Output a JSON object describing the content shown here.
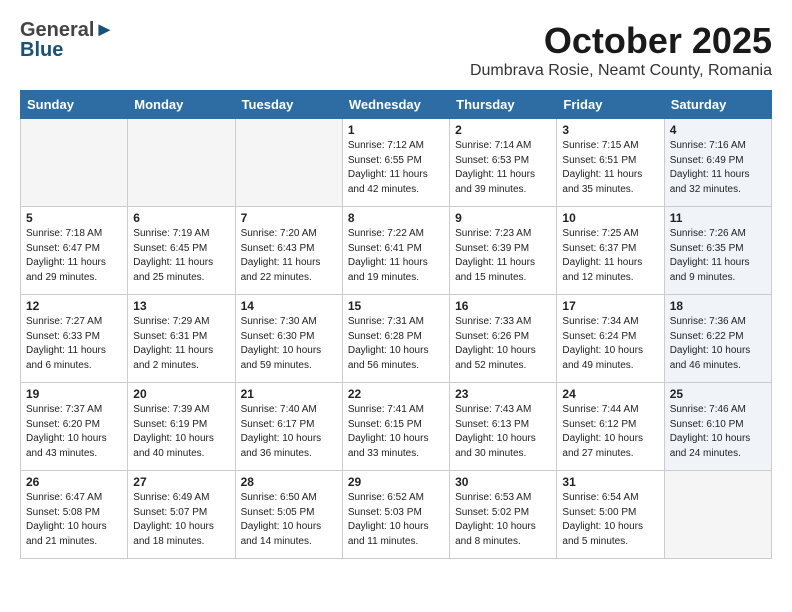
{
  "header": {
    "logo_general": "General",
    "logo_blue": "Blue",
    "month": "October 2025",
    "location": "Dumbrava Rosie, Neamt County, Romania"
  },
  "days_of_week": [
    "Sunday",
    "Monday",
    "Tuesday",
    "Wednesday",
    "Thursday",
    "Friday",
    "Saturday"
  ],
  "weeks": [
    [
      {
        "day": "",
        "info": ""
      },
      {
        "day": "",
        "info": ""
      },
      {
        "day": "",
        "info": ""
      },
      {
        "day": "1",
        "info": "Sunrise: 7:12 AM\nSunset: 6:55 PM\nDaylight: 11 hours\nand 42 minutes."
      },
      {
        "day": "2",
        "info": "Sunrise: 7:14 AM\nSunset: 6:53 PM\nDaylight: 11 hours\nand 39 minutes."
      },
      {
        "day": "3",
        "info": "Sunrise: 7:15 AM\nSunset: 6:51 PM\nDaylight: 11 hours\nand 35 minutes."
      },
      {
        "day": "4",
        "info": "Sunrise: 7:16 AM\nSunset: 6:49 PM\nDaylight: 11 hours\nand 32 minutes."
      }
    ],
    [
      {
        "day": "5",
        "info": "Sunrise: 7:18 AM\nSunset: 6:47 PM\nDaylight: 11 hours\nand 29 minutes."
      },
      {
        "day": "6",
        "info": "Sunrise: 7:19 AM\nSunset: 6:45 PM\nDaylight: 11 hours\nand 25 minutes."
      },
      {
        "day": "7",
        "info": "Sunrise: 7:20 AM\nSunset: 6:43 PM\nDaylight: 11 hours\nand 22 minutes."
      },
      {
        "day": "8",
        "info": "Sunrise: 7:22 AM\nSunset: 6:41 PM\nDaylight: 11 hours\nand 19 minutes."
      },
      {
        "day": "9",
        "info": "Sunrise: 7:23 AM\nSunset: 6:39 PM\nDaylight: 11 hours\nand 15 minutes."
      },
      {
        "day": "10",
        "info": "Sunrise: 7:25 AM\nSunset: 6:37 PM\nDaylight: 11 hours\nand 12 minutes."
      },
      {
        "day": "11",
        "info": "Sunrise: 7:26 AM\nSunset: 6:35 PM\nDaylight: 11 hours\nand 9 minutes."
      }
    ],
    [
      {
        "day": "12",
        "info": "Sunrise: 7:27 AM\nSunset: 6:33 PM\nDaylight: 11 hours\nand 6 minutes."
      },
      {
        "day": "13",
        "info": "Sunrise: 7:29 AM\nSunset: 6:31 PM\nDaylight: 11 hours\nand 2 minutes."
      },
      {
        "day": "14",
        "info": "Sunrise: 7:30 AM\nSunset: 6:30 PM\nDaylight: 10 hours\nand 59 minutes."
      },
      {
        "day": "15",
        "info": "Sunrise: 7:31 AM\nSunset: 6:28 PM\nDaylight: 10 hours\nand 56 minutes."
      },
      {
        "day": "16",
        "info": "Sunrise: 7:33 AM\nSunset: 6:26 PM\nDaylight: 10 hours\nand 52 minutes."
      },
      {
        "day": "17",
        "info": "Sunrise: 7:34 AM\nSunset: 6:24 PM\nDaylight: 10 hours\nand 49 minutes."
      },
      {
        "day": "18",
        "info": "Sunrise: 7:36 AM\nSunset: 6:22 PM\nDaylight: 10 hours\nand 46 minutes."
      }
    ],
    [
      {
        "day": "19",
        "info": "Sunrise: 7:37 AM\nSunset: 6:20 PM\nDaylight: 10 hours\nand 43 minutes."
      },
      {
        "day": "20",
        "info": "Sunrise: 7:39 AM\nSunset: 6:19 PM\nDaylight: 10 hours\nand 40 minutes."
      },
      {
        "day": "21",
        "info": "Sunrise: 7:40 AM\nSunset: 6:17 PM\nDaylight: 10 hours\nand 36 minutes."
      },
      {
        "day": "22",
        "info": "Sunrise: 7:41 AM\nSunset: 6:15 PM\nDaylight: 10 hours\nand 33 minutes."
      },
      {
        "day": "23",
        "info": "Sunrise: 7:43 AM\nSunset: 6:13 PM\nDaylight: 10 hours\nand 30 minutes."
      },
      {
        "day": "24",
        "info": "Sunrise: 7:44 AM\nSunset: 6:12 PM\nDaylight: 10 hours\nand 27 minutes."
      },
      {
        "day": "25",
        "info": "Sunrise: 7:46 AM\nSunset: 6:10 PM\nDaylight: 10 hours\nand 24 minutes."
      }
    ],
    [
      {
        "day": "26",
        "info": "Sunrise: 6:47 AM\nSunset: 5:08 PM\nDaylight: 10 hours\nand 21 minutes."
      },
      {
        "day": "27",
        "info": "Sunrise: 6:49 AM\nSunset: 5:07 PM\nDaylight: 10 hours\nand 18 minutes."
      },
      {
        "day": "28",
        "info": "Sunrise: 6:50 AM\nSunset: 5:05 PM\nDaylight: 10 hours\nand 14 minutes."
      },
      {
        "day": "29",
        "info": "Sunrise: 6:52 AM\nSunset: 5:03 PM\nDaylight: 10 hours\nand 11 minutes."
      },
      {
        "day": "30",
        "info": "Sunrise: 6:53 AM\nSunset: 5:02 PM\nDaylight: 10 hours\nand 8 minutes."
      },
      {
        "day": "31",
        "info": "Sunrise: 6:54 AM\nSunset: 5:00 PM\nDaylight: 10 hours\nand 5 minutes."
      },
      {
        "day": "",
        "info": ""
      }
    ]
  ]
}
